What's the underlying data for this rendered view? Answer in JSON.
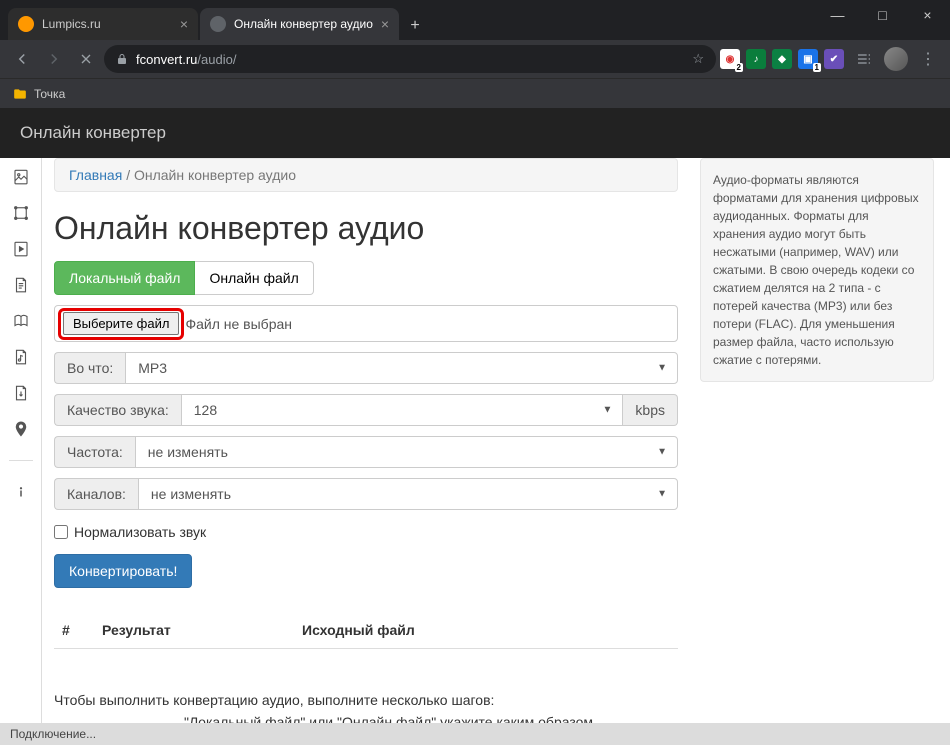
{
  "window": {
    "min": "—",
    "max": "□",
    "close": "×"
  },
  "tabs": [
    {
      "title": "Lumpics.ru"
    },
    {
      "title": "Онлайн конвертер аудио"
    }
  ],
  "url": {
    "domain": "fconvert.ru",
    "path": "/audio/"
  },
  "bookmarks": {
    "folder": "Точка"
  },
  "header": {
    "title": "Онлайн конвертер"
  },
  "breadcrumb": {
    "home": "Главная",
    "sep": "/",
    "current": "Онлайн конвертер аудио"
  },
  "page_title": "Онлайн конвертер аудио",
  "source_tabs": {
    "local": "Локальный файл",
    "online": "Онлайн файл"
  },
  "file_input": {
    "button": "Выберите файл",
    "status": "Файл не выбран"
  },
  "fields": {
    "to_what": {
      "label": "Во что:",
      "value": "MP3"
    },
    "quality": {
      "label": "Качество звука:",
      "value": "128",
      "suffix": "kbps"
    },
    "freq": {
      "label": "Частота:",
      "value": "не изменять"
    },
    "channels": {
      "label": "Каналов:",
      "value": "не изменять"
    }
  },
  "normalize": {
    "label": "Нормализовать звук"
  },
  "convert_button": "Конвертировать!",
  "results": {
    "num": "#",
    "result": "Результат",
    "source": "Исходный файл"
  },
  "help": {
    "line1": "Чтобы выполнить конвертацию аудио, выполните несколько шагов:",
    "line2": "\"Локальный файл\" или \"Онлайн файл\" укажите каким образом"
  },
  "sidebar_info": "Аудио-форматы являются форматами для хранения цифровых аудиоданных. Форматы для хранения аудио могут быть несжатыми (например, WAV) или сжатыми. В свою очередь кодеки со сжатием делятся на 2 типа - с потерей качества (MP3) или без потери (FLAC). Для уменьшения размер файла, часто использую сжатие с потерями.",
  "status": "Подключение..."
}
